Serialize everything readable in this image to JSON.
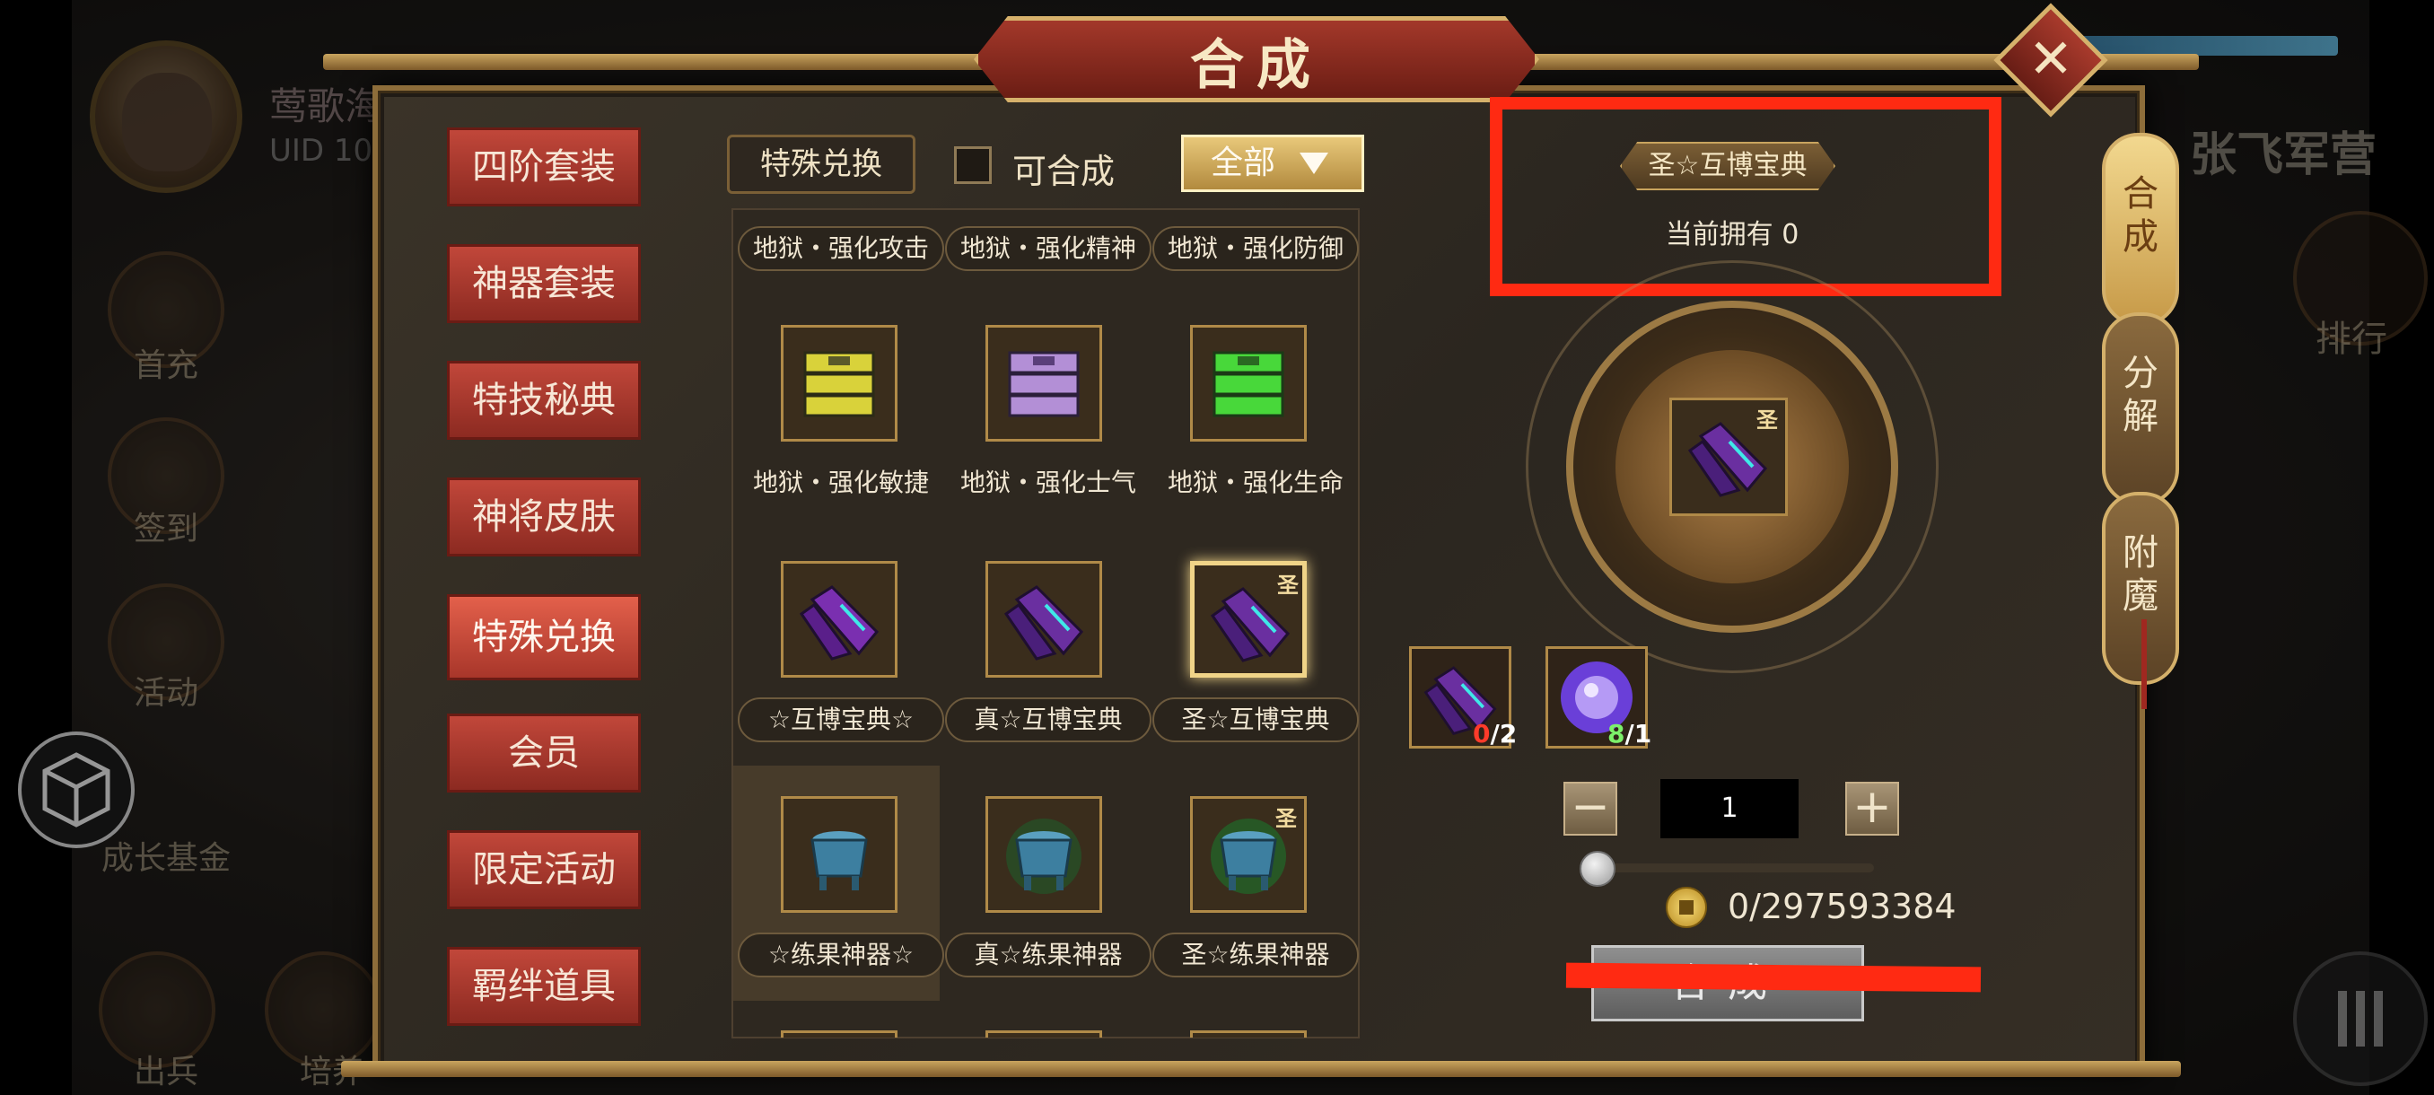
{
  "hud": {
    "player_name": "莺歌海",
    "uid_label": "UID 10",
    "left_buttons": [
      "首充",
      "签到",
      "活动",
      "成长基金",
      "出兵",
      "培养"
    ],
    "camp_title": "张飞军营",
    "rank_label": "排行",
    "cube_icon": "cube-icon",
    "menu_icon": "menu-icon"
  },
  "dialog": {
    "title": "合成",
    "close_icon": "close-icon"
  },
  "categories": [
    {
      "label": "四阶套装",
      "active": false
    },
    {
      "label": "神器套装",
      "active": false
    },
    {
      "label": "特技秘典",
      "active": false
    },
    {
      "label": "神将皮肤",
      "active": false
    },
    {
      "label": "特殊兑换",
      "active": true
    },
    {
      "label": "会员",
      "active": false
    },
    {
      "label": "限定活动",
      "active": false
    },
    {
      "label": "羁绊道具",
      "active": false
    }
  ],
  "filter": {
    "tab_label": "特殊兑换",
    "checkbox_label": "可合成",
    "dropdown_value": "全部"
  },
  "grid": {
    "row0_labels": [
      "地狱・强化攻击",
      "地狱・强化精神",
      "地狱・强化防御"
    ],
    "row1": [
      {
        "label": "地狱・强化敏捷",
        "icon": "yellow-book-icon",
        "color": "#d9d23a"
      },
      {
        "label": "地狱・强化士气",
        "icon": "purple-book-icon",
        "color": "#b38fd6"
      },
      {
        "label": "地狱・强化生命",
        "icon": "green-book-icon",
        "color": "#48d83a"
      }
    ],
    "row2": [
      {
        "label": "☆互博宝典☆",
        "icon": "scroll-book-icon"
      },
      {
        "label": "真☆互博宝典",
        "icon": "scroll-book-icon"
      },
      {
        "label": "圣☆互博宝典",
        "icon": "scroll-book-icon",
        "mark": "圣",
        "selected": true
      }
    ],
    "row3": [
      {
        "label": "☆练果神器☆",
        "icon": "cauldron-icon"
      },
      {
        "label": "真☆练果神器",
        "icon": "cauldron-icon"
      },
      {
        "label": "圣☆练果神器",
        "icon": "cauldron-icon",
        "mark": "圣"
      }
    ]
  },
  "detail": {
    "name": "圣☆互博宝典",
    "owned": "当前拥有 0",
    "center_mark": "圣",
    "materials": [
      {
        "icon": "scroll-book-icon",
        "have": "0",
        "need": "/2"
      },
      {
        "icon": "purple-crystal-icon",
        "have": "8",
        "need": "/1"
      }
    ],
    "quantity": "1",
    "minus": "−",
    "plus": "+",
    "cost": "0/297593384",
    "coin_icon": "coin-icon",
    "craft_button": "合成"
  },
  "side_tabs": [
    {
      "label": "合成",
      "active": true
    },
    {
      "label": "分解",
      "active": false
    },
    {
      "label": "附魔",
      "active": false
    }
  ],
  "colors": {
    "annotation_red": "#ff2a12",
    "category_red": "#c1473a",
    "gold": "#d6b16b"
  }
}
